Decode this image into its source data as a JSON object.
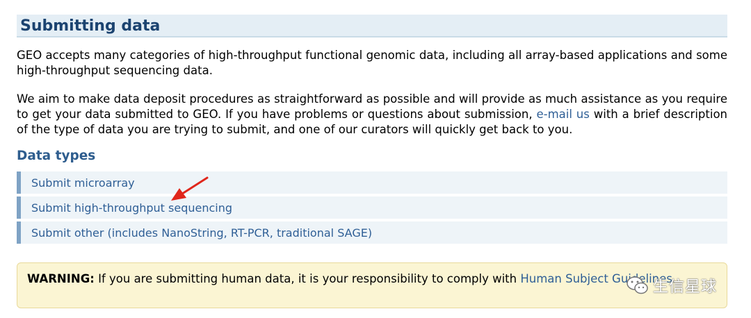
{
  "section": {
    "title": "Submitting data"
  },
  "intro": {
    "p1": "GEO accepts many categories of high-throughput functional genomic data, including all array-based applications and some high-throughput sequencing data.",
    "p2_before": "We aim to make data deposit procedures as straightforward as possible and will provide as much assistance as you require to get your data submitted to GEO. If you have problems or questions about submission, ",
    "p2_link": "e-mail us",
    "p2_after": " with a brief description of the type of data you are trying to submit, and one of our curators will quickly get back to you."
  },
  "data_types": {
    "heading": "Data types",
    "items": [
      {
        "label": "Submit microarray"
      },
      {
        "label": "Submit high-throughput sequencing"
      },
      {
        "label": "Submit other (includes NanoString, RT-PCR, traditional SAGE)"
      }
    ]
  },
  "warning": {
    "label": "WARNING:",
    "text_before": " If you are submitting human data, it is your responsibility to comply with ",
    "link": "Human Subject Guidelines",
    "text_after": "."
  },
  "annotation": {
    "arrow_color": "#e0261b",
    "arrow_target": "Submit high-throughput sequencing"
  },
  "watermark": {
    "text": "生信星球",
    "icon": "wechat-icon"
  },
  "colors": {
    "header_bg": "#e4eef5",
    "header_text": "#1b4370",
    "link": "#2f5f96",
    "item_bg": "#eef4f8",
    "item_border": "#7fa3c5",
    "warning_bg": "#fbf5d3"
  }
}
